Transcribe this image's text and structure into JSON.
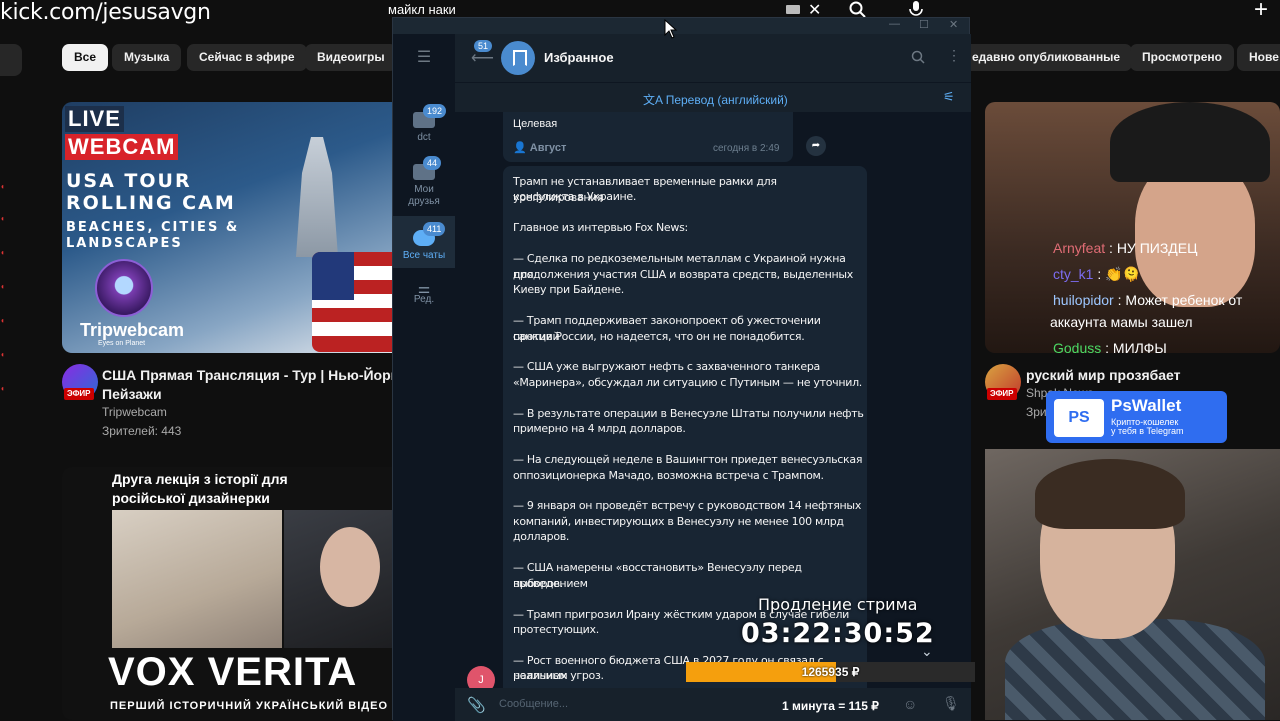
{
  "overlay": {
    "channel_url": "kick.com/jesusavgn"
  },
  "youtube": {
    "search_query": "майкл наки",
    "chips": [
      "Все",
      "Музыка",
      "Сейчас в эфире",
      "Видеоигры",
      "едавно опубликованные",
      "Просмотрено",
      "Нове"
    ],
    "video1": {
      "thumb": {
        "live": "LIVE",
        "webcam": "WEBCAM",
        "line1": "USA TOUR",
        "line2": "ROLLING CAM",
        "line3": "BEACHES, CITIES &",
        "line4": "LANDSCAPES",
        "brand": "Tripwebcam",
        "brand_tag": "Eyes on Planet"
      },
      "live_tag": "ЭФИР",
      "title_line1": "США Прямая Трансляция - Тур | Нью-Йорк, Го",
      "title_line2": "Пейзажи",
      "channel": "Tripwebcam",
      "viewers": "Зрителей: 443"
    },
    "video2": {
      "caption_line1": "Друга лекція з історії для",
      "caption_line2": "російської дизайнерки",
      "brand": "VOX VERITA",
      "subtitle": "ПЕРШИЙ ІСТОРИЧНИЙ УКРАЇНСЬКИЙ ВІДЕО"
    },
    "video3": {
      "live_tag": "ЭФИР",
      "title": "руский мир прозябает",
      "channel": "Shpak News",
      "meta": "Зри"
    }
  },
  "stream_chat": [
    {
      "user": "Arnyfeat",
      "text": "НУ ПИЗДЕЦ",
      "color": "#e06c75"
    },
    {
      "user": "cty_k1",
      "text": "👏🫠",
      "color": "#7c6cf0"
    },
    {
      "user": "huilopidor",
      "text": "Может ребенок от",
      "color": "#9ec7ff"
    },
    {
      "user": "",
      "text": "аккаунта мамы зашел",
      "color": "#ffffff"
    },
    {
      "user": "Goduss",
      "text": "МИЛФЫ",
      "color": "#4cd964"
    }
  ],
  "psw_ad": {
    "logo": "PS",
    "title": "PsWallet",
    "sub1": "Крипто-кошелек",
    "sub2": "у тебя в Telegram"
  },
  "telegram": {
    "folders": [
      {
        "label": "dct",
        "count": "192"
      },
      {
        "label": "Мои друзья",
        "count": "44"
      },
      {
        "label": "Все чаты",
        "count": "411"
      },
      {
        "label": "Ред.",
        "count": ""
      }
    ],
    "back_badge": "51",
    "chat_title": "Избранное",
    "translate_label": "Перевод (английский)",
    "prev_message": {
      "text": "Целевая",
      "forward_from": "Август",
      "time": "сегодня в 2:49"
    },
    "message_lines": [
      "Трамп не устанавливает временные рамки для урегулирования",
      "конфликта в Украине.",
      "",
      "Главное из интервью Fox News:",
      "",
      "— Сделка по редкоземельным металлам с Украиной нужна для",
      "продолжения участия США и возврата средств, выделенных",
      "Киеву при Байдене.",
      "",
      "— Трамп поддерживает законопроект об ужесточении санкций",
      "против России, но надеется, что он не понадобится.",
      "",
      "— США уже выгружают нефть с захваченного танкера",
      "«Маринера», обсуждал ли ситуацию с Путиным — не уточнил.",
      "",
      "— В результате операции в Венесуэле Штаты получили нефть",
      "примерно на 4 млрд долларов.",
      "",
      "— На следующей неделе в Вашингтон приедет венесуэльская",
      "оппозиционерка Мачадо, возможна встреча с Трампом.",
      "",
      "— 9 января он проведёт встречу с руководством 14 нефтяных",
      "компаний, инвестирующих в Венесуэлу не менее 100 млрд",
      "долларов.",
      "",
      "— США намерены «восстановить» Венесуэлу перед проведением",
      "выборов.",
      "",
      "— Трамп пригрозил Ирану жёстким ударом в случае гибели",
      "протестующих.",
      "",
      "— Рост военного бюджета США в 2027 году он связал с наличием",
      "реальных угроз."
    ],
    "sender_initial": "J",
    "input_placeholder": "Сообщение..."
  },
  "stream_overlay": {
    "prolong_label": "Продление стрима",
    "timer": "03:22:30:52",
    "amount": "1265935 ₽",
    "progress": 0.52,
    "rate": "1 минута = 115 ₽"
  }
}
